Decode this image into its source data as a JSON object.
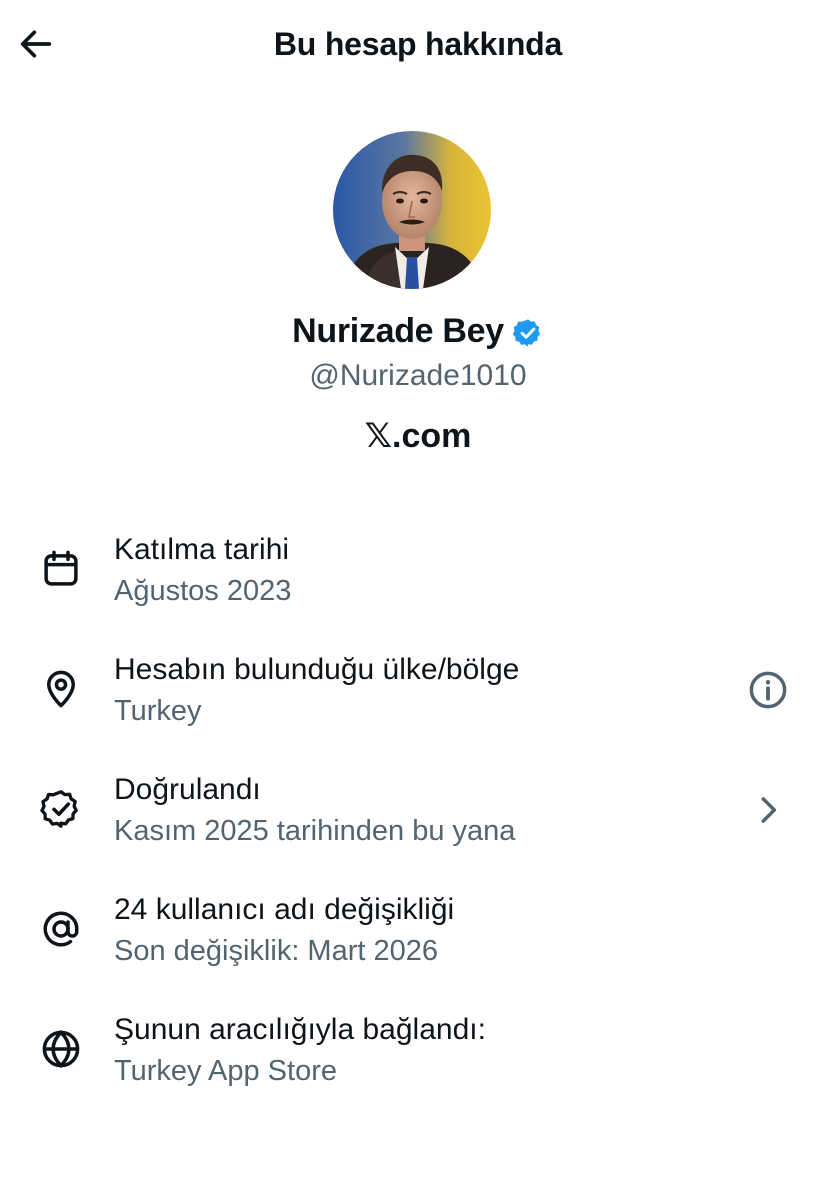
{
  "header": {
    "title": "Bu hesap hakkında",
    "back_icon": "arrow-left-icon"
  },
  "profile": {
    "name": "Nurizade Bey",
    "handle": "@Nurizade1010",
    "verified": true,
    "verified_color": "#1d9bf0",
    "brand_logo": "𝕏",
    "brand_domain": ".com"
  },
  "rows": [
    {
      "icon": "calendar-icon",
      "title": "Katılma tarihi",
      "subtitle": "Ağustos 2023"
    },
    {
      "icon": "location-pin-icon",
      "title": "Hesabın bulunduğu ülke/bölge",
      "subtitle": "Turkey",
      "action_icon": "info-icon"
    },
    {
      "icon": "verified-badge-icon",
      "title": "Doğrulandı",
      "subtitle": "Kasım 2025 tarihinden bu yana",
      "action_icon": "chevron-right-icon"
    },
    {
      "icon": "at-sign-icon",
      "title": "24 kullanıcı adı değişikliği",
      "subtitle": "Son değişiklik: Mart 2026"
    },
    {
      "icon": "globe-icon",
      "title": "Şunun aracılığıyla bağlandı:",
      "subtitle": "Turkey App Store"
    }
  ],
  "colors": {
    "text_primary": "#0f1419",
    "text_secondary": "#536471",
    "background": "#ffffff"
  }
}
